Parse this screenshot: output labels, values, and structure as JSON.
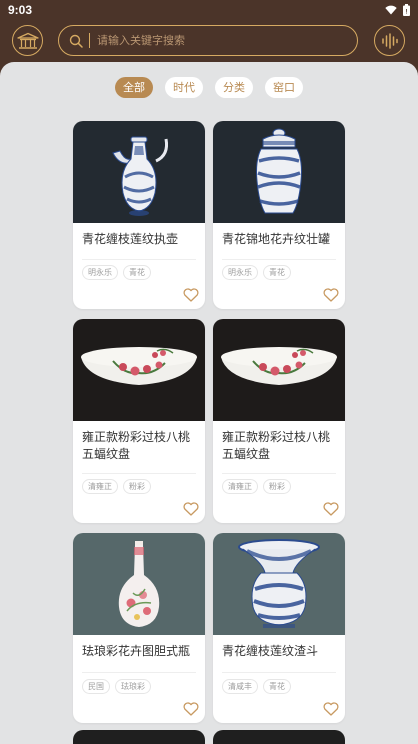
{
  "status": {
    "time": "9:03"
  },
  "search": {
    "placeholder": "请输入关键字搜索"
  },
  "filters": [
    {
      "label": "全部",
      "active": true
    },
    {
      "label": "时代",
      "active": false
    },
    {
      "label": "分类",
      "active": false
    },
    {
      "label": "窑口",
      "active": false
    }
  ],
  "cards": [
    {
      "title": "青花缠枝莲纹执壶",
      "tags": [
        "明永乐",
        "青花"
      ]
    },
    {
      "title": "青花锦地花卉纹壮罐",
      "tags": [
        "明永乐",
        "青花"
      ]
    },
    {
      "title": "雍正款粉彩过枝八桃五蝠纹盘",
      "tags": [
        "清雍正",
        "粉彩"
      ]
    },
    {
      "title": "雍正款粉彩过枝八桃五蝠纹盘",
      "tags": [
        "清雍正",
        "粉彩"
      ]
    },
    {
      "title": "珐琅彩花卉图胆式瓶",
      "tags": [
        "民国",
        "珐琅彩"
      ]
    },
    {
      "title": "青花缠枝莲纹渣斗",
      "tags": [
        "清咸丰",
        "青花"
      ]
    }
  ],
  "colors": {
    "brand_brown": "#4b3429",
    "accent_gold": "#d6aa62",
    "chip_active": "#b88a52",
    "heart": "#c89a62"
  },
  "icons": {
    "home": "palace-icon",
    "search": "search-icon",
    "audio": "sound-wave-icon",
    "favorite": "heart-icon"
  }
}
